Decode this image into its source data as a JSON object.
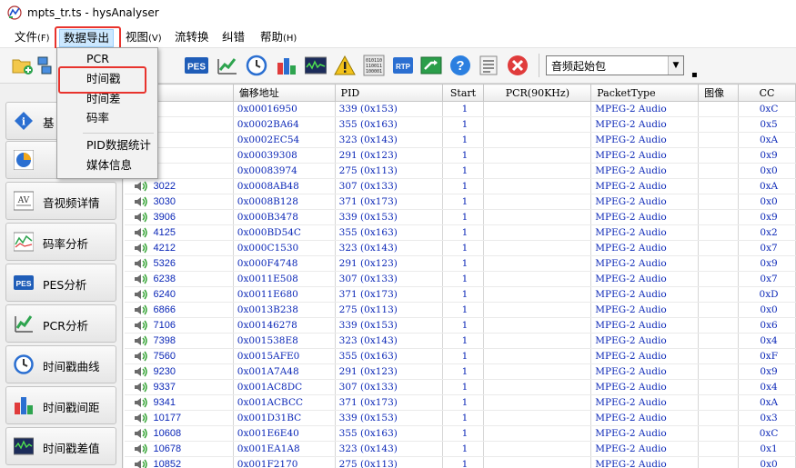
{
  "window": {
    "title": "mpts_tr.ts - hysAnalyser"
  },
  "menubar": [
    {
      "label": "文件",
      "acc": "(F)"
    },
    {
      "label": "数据导出",
      "acc": ""
    },
    {
      "label": "视图",
      "acc": "(V)"
    },
    {
      "label": "流转换",
      "acc": ""
    },
    {
      "label": "纠错",
      "acc": ""
    },
    {
      "label": "帮助",
      "acc": "(H)"
    }
  ],
  "dropdown": {
    "items": [
      "PCR",
      "时间戳",
      "时间差",
      "码率",
      "PID数据统计",
      "媒体信息"
    ],
    "highlighted": "时间戳"
  },
  "toolbar": {
    "combo_value": "音频起始包",
    "icons": [
      "add-folder-icon",
      "network-icon",
      "pes-icon",
      "pcr-chart-icon",
      "clock-icon",
      "bar-chart-icon",
      "waveform-icon",
      "warning-icon",
      "binary-data-icon",
      "rtp-icon",
      "export-icon",
      "help-icon",
      "list-icon",
      "close-icon"
    ]
  },
  "sidebar": {
    "items": [
      "基",
      "",
      "音视频详情",
      "码率分析",
      "PES分析",
      "PCR分析",
      "时间戳曲线",
      "时间戳间距",
      "时间戳差值"
    ],
    "icons": [
      "info-icon",
      "pie-chart-icon",
      "av-icon",
      "bitrate-icon",
      "pes-icon",
      "pcr-icon",
      "timestamp-curve-icon",
      "timestamp-interval-icon",
      "timestamp-diff-icon"
    ]
  },
  "table": {
    "headers": [
      "",
      "偏移地址",
      "PID",
      "Start",
      "PCR(90KHz)",
      "PacketType",
      "图像",
      "CC"
    ],
    "rows": [
      [
        "",
        "0x00016950",
        "339  (0x153)",
        "1",
        "",
        "MPEG-2 Audio",
        "",
        "0xC"
      ],
      [
        "",
        "0x0002BA64",
        "355  (0x163)",
        "1",
        "",
        "MPEG-2 Audio",
        "",
        "0x5"
      ],
      [
        "",
        "0x0002EC54",
        "323  (0x143)",
        "1",
        "",
        "MPEG-2 Audio",
        "",
        "0xA"
      ],
      [
        "",
        "0x00039308",
        "291  (0x123)",
        "1",
        "",
        "MPEG-2 Audio",
        "",
        "0x9"
      ],
      [
        "",
        "0x00083974",
        "275  (0x113)",
        "1",
        "",
        "MPEG-2 Audio",
        "",
        "0x0"
      ],
      [
        "3022",
        "0x0008AB48",
        "307  (0x133)",
        "1",
        "",
        "MPEG-2 Audio",
        "",
        "0xA"
      ],
      [
        "3030",
        "0x0008B128",
        "371  (0x173)",
        "1",
        "",
        "MPEG-2 Audio",
        "",
        "0x0"
      ],
      [
        "3906",
        "0x000B3478",
        "339  (0x153)",
        "1",
        "",
        "MPEG-2 Audio",
        "",
        "0x9"
      ],
      [
        "4125",
        "0x000BD54C",
        "355  (0x163)",
        "1",
        "",
        "MPEG-2 Audio",
        "",
        "0x2"
      ],
      [
        "4212",
        "0x000C1530",
        "323  (0x143)",
        "1",
        "",
        "MPEG-2 Audio",
        "",
        "0x7"
      ],
      [
        "5326",
        "0x000F4748",
        "291  (0x123)",
        "1",
        "",
        "MPEG-2 Audio",
        "",
        "0x9"
      ],
      [
        "6238",
        "0x0011E508",
        "307  (0x133)",
        "1",
        "",
        "MPEG-2 Audio",
        "",
        "0x7"
      ],
      [
        "6240",
        "0x0011E680",
        "371  (0x173)",
        "1",
        "",
        "MPEG-2 Audio",
        "",
        "0xD"
      ],
      [
        "6866",
        "0x0013B238",
        "275  (0x113)",
        "1",
        "",
        "MPEG-2 Audio",
        "",
        "0x0"
      ],
      [
        "7106",
        "0x00146278",
        "339  (0x153)",
        "1",
        "",
        "MPEG-2 Audio",
        "",
        "0x6"
      ],
      [
        "7398",
        "0x001538E8",
        "323  (0x143)",
        "1",
        "",
        "MPEG-2 Audio",
        "",
        "0x4"
      ],
      [
        "7560",
        "0x0015AFE0",
        "355  (0x163)",
        "1",
        "",
        "MPEG-2 Audio",
        "",
        "0xF"
      ],
      [
        "9230",
        "0x001A7A48",
        "291  (0x123)",
        "1",
        "",
        "MPEG-2 Audio",
        "",
        "0x9"
      ],
      [
        "9337",
        "0x001AC8DC",
        "307  (0x133)",
        "1",
        "",
        "MPEG-2 Audio",
        "",
        "0x4"
      ],
      [
        "9341",
        "0x001ACBCC",
        "371  (0x173)",
        "1",
        "",
        "MPEG-2 Audio",
        "",
        "0xA"
      ],
      [
        "10177",
        "0x001D31BC",
        "339  (0x153)",
        "1",
        "",
        "MPEG-2 Audio",
        "",
        "0x3"
      ],
      [
        "10608",
        "0x001E6E40",
        "355  (0x163)",
        "1",
        "",
        "MPEG-2 Audio",
        "",
        "0xC"
      ],
      [
        "10678",
        "0x001EA1A8",
        "323  (0x143)",
        "1",
        "",
        "MPEG-2 Audio",
        "",
        "0x1"
      ],
      [
        "10852",
        "0x001F2170",
        "275  (0x113)",
        "1",
        "",
        "MPEG-2 Audio",
        "",
        "0x0"
      ]
    ]
  },
  "colors": {
    "highlight_red": "#e8332d",
    "data_blue": "#0b27b7",
    "menu_active": "#cce8ff"
  }
}
